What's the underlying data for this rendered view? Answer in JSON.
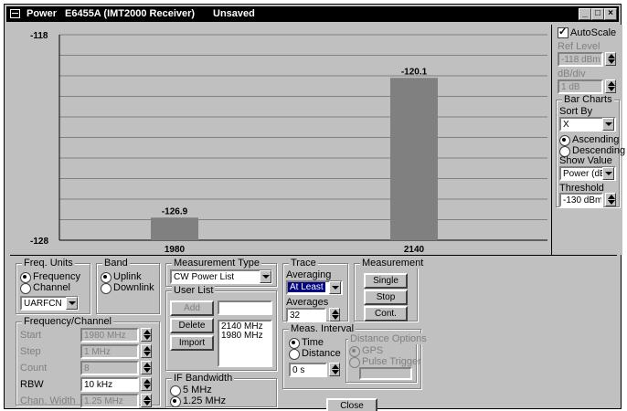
{
  "window": {
    "title": "Power",
    "subtitle": "E6455A (IMT2000 Receiver)",
    "status": "Unsaved"
  },
  "chart_data": {
    "type": "bar",
    "categories": [
      "1980",
      "2140"
    ],
    "values": [
      -126.9,
      -120.1
    ],
    "value_labels": [
      "-126.9",
      "-120.1"
    ],
    "ylim": [
      -128,
      -118
    ],
    "ytick_labels": [
      "-118",
      "-128"
    ],
    "grid": true,
    "bar_color": "#808080"
  },
  "right": {
    "autoscale": "AutoScale",
    "ref_level_label": "Ref Level",
    "ref_level_value": "-118 dBm",
    "db_div_label": "dB/div",
    "db_div_value": "1 dB",
    "bar_charts_label": "Bar Charts",
    "sort_by_label": "Sort By",
    "sort_by_value": "X",
    "ascending": "Ascending",
    "descending": "Descending",
    "show_value_label": "Show Value",
    "show_value_value": "Power (dBm)",
    "threshold_label": "Threshold",
    "threshold_value": "-130 dBm"
  },
  "freq_units": {
    "label": "Freq. Units",
    "frequency": "Frequency",
    "channel": "Channel",
    "standard": "UARFCN"
  },
  "band": {
    "label": "Band",
    "uplink": "Uplink",
    "downlink": "Downlink"
  },
  "freq_channel": {
    "label": "Frequency/Channel",
    "start_label": "Start",
    "start_value": "1980 MHz",
    "step_label": "Step",
    "step_value": "1 MHz",
    "count_label": "Count",
    "count_value": "8",
    "rbw_label": "RBW",
    "rbw_value": "10 kHz",
    "chan_width_label": "Chan. Width",
    "chan_width_value": "1.25 MHz"
  },
  "meas_type": {
    "label": "Measurement Type",
    "value": "CW Power List"
  },
  "user_list": {
    "label": "User List",
    "add": "Add",
    "delete": "Delete",
    "import": "Import",
    "input_value": "",
    "items": [
      "2140 MHz",
      "1980 MHz"
    ]
  },
  "if_bw": {
    "label": "IF Bandwidth",
    "opt1": "5 MHz",
    "opt2": "1.25 MHz"
  },
  "trace": {
    "label": "Trace",
    "averaging_label": "Averaging",
    "averaging_value": "At Least",
    "averages_label": "Averages",
    "averages_value": "32"
  },
  "measurement": {
    "label": "Measurement",
    "single": "Single",
    "stop": "Stop",
    "cont": "Cont."
  },
  "meas_interval": {
    "label": "Meas. Interval",
    "time": "Time",
    "distance": "Distance",
    "value": "0 s",
    "dist_options_label": "Distance Options",
    "gps": "GPS",
    "pulse": "Pulse Trigger"
  },
  "close": "Close"
}
